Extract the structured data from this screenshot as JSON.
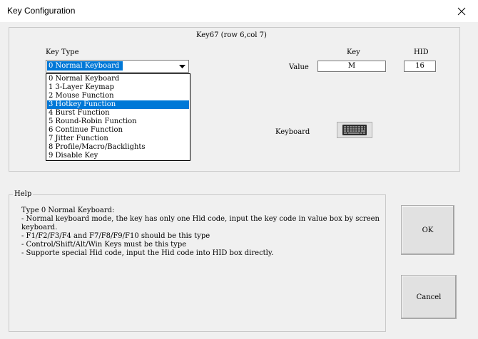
{
  "window": {
    "title": "Key Configuration",
    "close_label": "close"
  },
  "key_header": "Key67 (row 6,col 7)",
  "key_type": {
    "label": "Key Type",
    "selected": "0 Normal Keyboard",
    "options": [
      "0 Normal Keyboard",
      "1 3-Layer Keymap",
      "2 Mouse Function",
      "3 Hotkey Function",
      "4 Burst Function",
      "5 Round-Robin Function",
      "6 Continue Function",
      "7 Jitter Function",
      "8 Profile/Macro/Backlights",
      "9 Disable Key"
    ],
    "highlighted_index": 3
  },
  "value": {
    "label": "Value",
    "key_header": "Key",
    "hid_header": "HID",
    "key_value": "M",
    "hid_value": "16"
  },
  "keyboard": {
    "label": "Keyboard",
    "icon": "keyboard-icon"
  },
  "help": {
    "legend": "Help",
    "text": "Type 0 Normal Keyboard:\n- Normal keyboard mode, the key has only one Hid code, input the key code in value box by screen keyboard.\n- F1/F2/F3/F4 and F7/F8/F9/F10 should be this type\n- Control/Shift/Alt/Win Keys must be this type\n- Supporte special Hid code, input the Hid code into HID box directly."
  },
  "buttons": {
    "ok": "OK",
    "cancel": "Cancel"
  },
  "colors": {
    "selection": "#0078d7",
    "background": "#f0f0f0",
    "titlebar": "#ffffff"
  }
}
